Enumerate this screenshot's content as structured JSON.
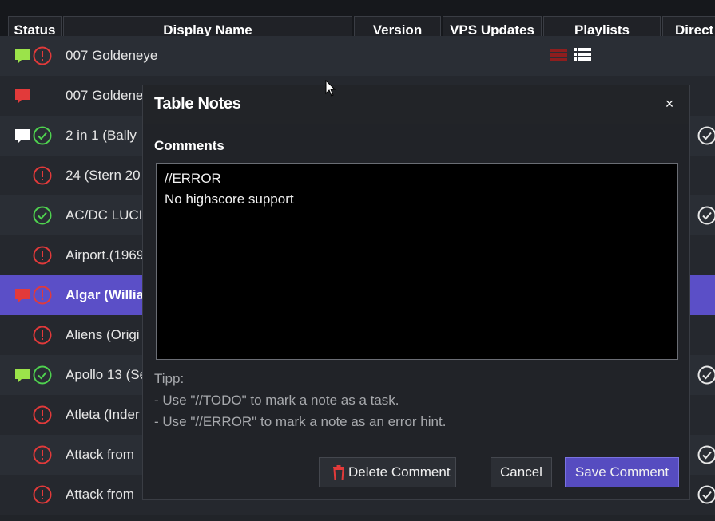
{
  "columns": [
    "Status",
    "Display Name",
    "Version",
    "VPS Updates",
    "Playlists",
    "Direct"
  ],
  "colors": {
    "selected_row": "#5b4fc7",
    "error_red": "#e23a3a",
    "ok_green": "#4fd24f",
    "comment_green": "#9be34a",
    "comment_red": "#e23a3a",
    "save_button": "#564cc0"
  },
  "rows": [
    {
      "name": "007 Goldeneye",
      "comment": "green",
      "status": "error",
      "playlists": true,
      "direct": false,
      "selected": false
    },
    {
      "name": "007 Goldene",
      "comment": "red",
      "status": "none",
      "playlists": false,
      "direct": false,
      "selected": false
    },
    {
      "name": "2 in 1 (Bally",
      "comment": "white",
      "status": "ok",
      "playlists": false,
      "direct": true,
      "selected": false
    },
    {
      "name": "24 (Stern 20",
      "comment": "none",
      "status": "error",
      "playlists": false,
      "direct": false,
      "selected": false
    },
    {
      "name": "AC/DC LUCI",
      "comment": "none",
      "status": "ok",
      "playlists": false,
      "direct": true,
      "selected": false
    },
    {
      "name": "Airport.(1969",
      "comment": "none",
      "status": "error",
      "playlists": false,
      "direct": false,
      "selected": false
    },
    {
      "name": "Algar (Willia",
      "comment": "red",
      "status": "error",
      "playlists": false,
      "direct": false,
      "selected": true
    },
    {
      "name": "Aliens (Origi",
      "comment": "none",
      "status": "error",
      "playlists": false,
      "direct": false,
      "selected": false
    },
    {
      "name": "Apollo 13 (Se",
      "comment": "green",
      "status": "ok",
      "playlists": false,
      "direct": true,
      "selected": false
    },
    {
      "name": "Atleta (Inder",
      "comment": "none",
      "status": "error",
      "playlists": false,
      "direct": false,
      "selected": false
    },
    {
      "name": "Attack from",
      "comment": "none",
      "status": "error",
      "playlists": false,
      "direct": true,
      "selected": false
    },
    {
      "name": "Attack from",
      "comment": "none",
      "status": "error",
      "playlists": false,
      "direct": true,
      "selected": false
    }
  ],
  "modal": {
    "title": "Table Notes",
    "close_label": "×",
    "comments_label": "Comments",
    "comment_text": "//ERROR\nNo highscore support",
    "tip_title": "Tipp:",
    "tip_1": "- Use \"//TODO\" to mark a note as a task.",
    "tip_2": "- Use \"//ERROR\" to mark a note as an error hint.",
    "delete_label": "Delete Comment",
    "cancel_label": "Cancel",
    "save_label": "Save Comment"
  },
  "icons": {
    "comment": "speech-bubble-icon",
    "error": "exclamation-circle-icon",
    "ok": "check-circle-icon",
    "playlist": "list-icon",
    "delete": "trash-icon",
    "close": "close-icon"
  }
}
